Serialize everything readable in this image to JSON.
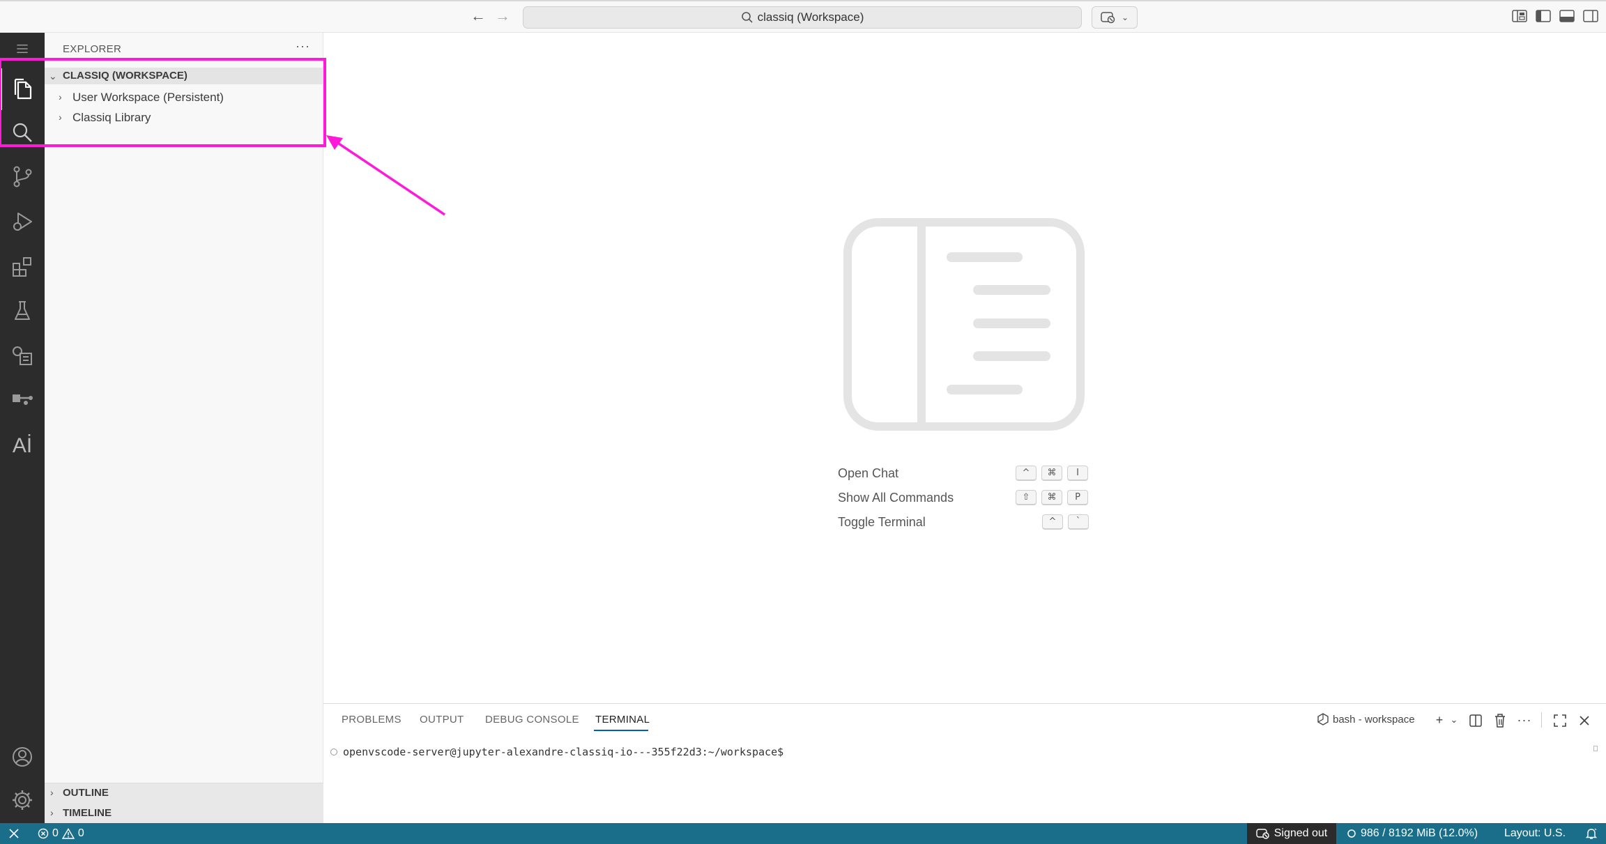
{
  "titlebar": {
    "back_icon": "arrow-left-icon",
    "forward_icon": "arrow-right-icon",
    "command_center_text": "classiq (Workspace)",
    "copilot_icon": "copilot-icon"
  },
  "activity_bar": {
    "items": [
      "menu",
      "explorer",
      "search",
      "source-control",
      "run-and-debug",
      "extensions",
      "testing",
      "jupyter",
      "remote",
      "ai"
    ],
    "bottom_items": [
      "accounts",
      "manage"
    ]
  },
  "sidebar": {
    "title": "EXPLORER",
    "more_label": "···",
    "workspace_label": "CLASSIQ (WORKSPACE)",
    "tree": [
      {
        "label": "User Workspace (Persistent)"
      },
      {
        "label": "Classiq Library"
      }
    ],
    "outline_label": "OUTLINE",
    "timeline_label": "TIMELINE"
  },
  "editor": {
    "hints": [
      {
        "label": "Open Chat",
        "keys": [
          "^",
          "⌘",
          "I"
        ]
      },
      {
        "label": "Show All Commands",
        "keys": [
          "⇧",
          "⌘",
          "P"
        ]
      },
      {
        "label": "Toggle Terminal",
        "keys": [
          "^",
          "`"
        ]
      }
    ]
  },
  "panel": {
    "tabs": [
      "PROBLEMS",
      "OUTPUT",
      "DEBUG CONSOLE",
      "TERMINAL"
    ],
    "active_tab": "TERMINAL",
    "terminal_name": "bash - workspace",
    "prompt": "openvscode-server@jupyter-alexandre-classiq-io---355f22d3:~/workspace$"
  },
  "statusbar": {
    "errors": "0",
    "warnings": "0",
    "signed_out": "Signed out",
    "memory": "986 / 8192 MiB (12.0%)",
    "layout": "Layout: U.S.",
    "accent": "#1b6e8a"
  },
  "annotation": {
    "color": "#ff1ad9"
  }
}
